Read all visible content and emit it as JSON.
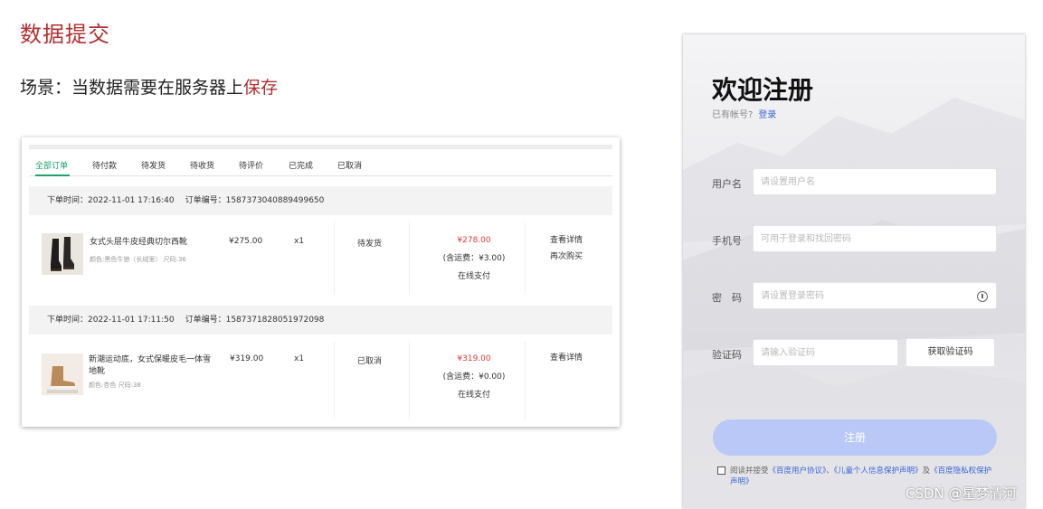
{
  "heading": "数据提交",
  "scene": {
    "prefix": "场景：当数据需要在服务器上",
    "highlight": "保存"
  },
  "orders": {
    "tabs": [
      "全部订单",
      "待付款",
      "待发货",
      "待收货",
      "待评价",
      "已完成",
      "已取消"
    ],
    "active_tab": 0,
    "accent": "#1aa36b",
    "list": [
      {
        "time_label": "下单时间：2022-11-01 17:16:40",
        "no_label": "订单编号：1587373040889499650",
        "name": "女式头层牛皮经典切尔西靴",
        "attr": "颜色:黑色牛猄（长绒里） 尺码:36",
        "unit_price": "¥275.00",
        "qty": "x1",
        "status": "待发货",
        "total": "¥278.00",
        "shipping": "(含运费：¥3.00)",
        "pay": "在线支付",
        "ops": [
          "查看详情",
          "再次购买"
        ]
      },
      {
        "time_label": "下单时间：2022-11-01 17:11:50",
        "no_label": "订单编号：1587371828051972098",
        "name": "新潮运动底，女式保暖皮毛一体雪地靴",
        "attr": "颜色:杏色 尺码:38",
        "unit_price": "¥319.00",
        "qty": "x1",
        "status": "已取消",
        "total": "¥319.00",
        "shipping": "(含运费：¥0.00)",
        "pay": "在线支付",
        "ops": [
          "查看详情"
        ]
      }
    ]
  },
  "register": {
    "title": "欢迎注册",
    "has_account": "已有帐号?",
    "login_link": "登录",
    "username_label": "用户名",
    "username_placeholder": "请设置用户名",
    "phone_label": "手机号",
    "phone_placeholder": "可用于登录和找回密码",
    "password_label": "密　码",
    "password_placeholder": "请设置登录密码",
    "code_label": "验证码",
    "code_placeholder": "请输入验证码",
    "get_code": "获取验证码",
    "submit": "注册",
    "agree_prefix": "阅读并接受",
    "agree_link1": "《百度用户协议》",
    "agree_sep": "、",
    "agree_link2": "《儿童个人信息保护声明》",
    "agree_and": "及",
    "agree_link3": "《百度隐私权保护声明》",
    "link_color": "#3a64d8",
    "submit_color": "#b9c8f7"
  },
  "watermark": "CSDN @星梦清河"
}
